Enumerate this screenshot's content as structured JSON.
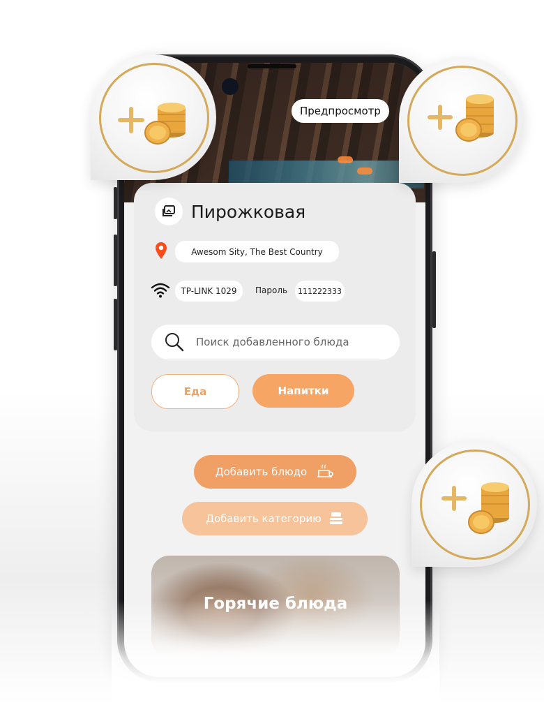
{
  "header": {
    "preview_label": "Предпросмотр"
  },
  "restaurant": {
    "name": "Пирожковая",
    "address": "Awesom Sity, The Best Country",
    "wifi_name": "TP-LINK 1029",
    "password_label": "Пароль",
    "password_value": "111222333"
  },
  "search": {
    "placeholder": "Поиск добавленного блюда"
  },
  "tabs": [
    {
      "label": "Еда"
    },
    {
      "label": "Напитки"
    }
  ],
  "actions": {
    "add_dish": "Добавить блюдо",
    "add_category": "Добавить  категорию"
  },
  "category_card": {
    "title": "Горячие блюда"
  },
  "colors": {
    "accent": "#f0a065",
    "accent_light": "#f6c39a",
    "pin": "#ff4a1a",
    "gold": "#d4a95a"
  },
  "icons": [
    "image-icon",
    "location-pin-icon",
    "wifi-icon",
    "search-icon",
    "tray-icon",
    "stack-icon",
    "coins-icon",
    "plus-icon"
  ]
}
